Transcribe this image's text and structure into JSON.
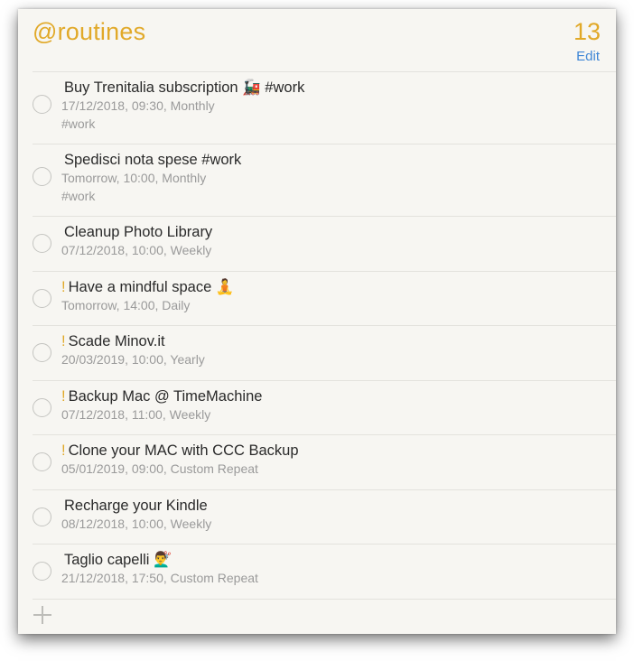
{
  "header": {
    "list_name": "@routines",
    "count": "13",
    "edit_label": "Edit"
  },
  "colors": {
    "accent": "#e1a929",
    "link": "#3e86d6",
    "background": "#f7f6f2"
  },
  "tasks": [
    {
      "title": "Buy Trenitalia subscription 🚂 #work",
      "priority": "",
      "detail": "17/12/2018, 09:30, Monthly",
      "tags": "#work"
    },
    {
      "title": "Spedisci nota spese  #work",
      "priority": "",
      "detail": "Tomorrow, 10:00, Monthly",
      "tags": "#work"
    },
    {
      "title": "Cleanup Photo Library",
      "priority": "",
      "detail": "07/12/2018, 10:00, Weekly"
    },
    {
      "title": "Have a mindful space 🧘",
      "priority": "!",
      "detail": "Tomorrow, 14:00, Daily"
    },
    {
      "title": "Scade Minov.it",
      "priority": "!",
      "detail": "20/03/2019, 10:00, Yearly"
    },
    {
      "title": "Backup Mac @ TimeMachine",
      "priority": "!",
      "detail": "07/12/2018, 11:00, Weekly"
    },
    {
      "title": "Clone  your MAC with CCC Backup",
      "priority": "!",
      "detail": "05/01/2019, 09:00, Custom Repeat"
    },
    {
      "title": "Recharge your Kindle",
      "priority": "",
      "detail": "08/12/2018, 10:00, Weekly"
    },
    {
      "title": "Taglio capelli 💇‍♂️",
      "priority": "",
      "detail": "21/12/2018, 17:50, Custom Repeat"
    }
  ],
  "add_icon": "plus-icon"
}
